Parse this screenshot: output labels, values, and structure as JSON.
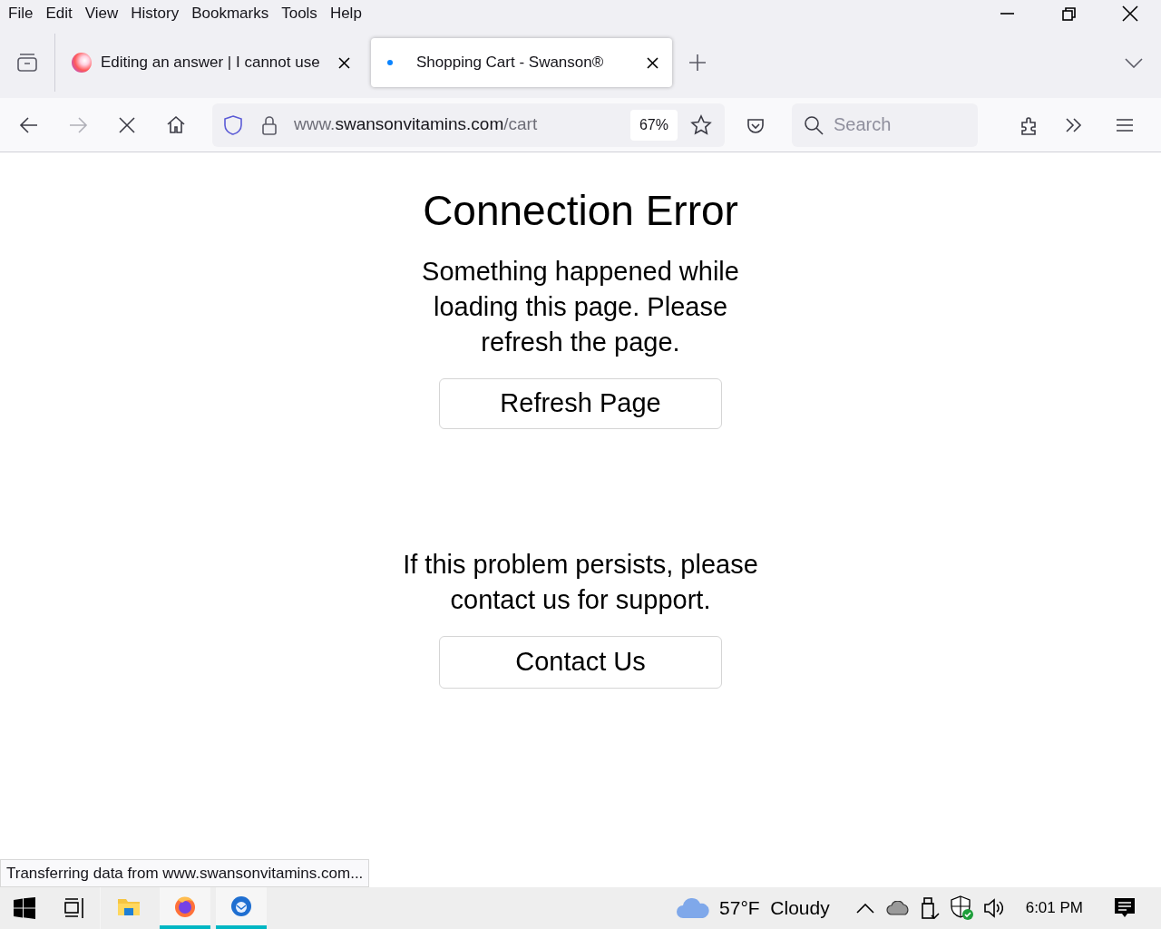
{
  "menu_bar": [
    "File",
    "Edit",
    "View",
    "History",
    "Bookmarks",
    "Tools",
    "Help"
  ],
  "tabs": [
    {
      "title": "Editing an answer | I cannot use",
      "selected": false,
      "kind": "favicon"
    },
    {
      "title": "Shopping Cart - Swanson®",
      "selected": true,
      "kind": "loading"
    }
  ],
  "nav_buttons": [
    {
      "kind": "back",
      "disabled": false
    },
    {
      "kind": "forward",
      "disabled": true
    },
    {
      "kind": "stop",
      "disabled": false
    },
    {
      "kind": "home",
      "disabled": false
    }
  ],
  "address_bar": {
    "prefix": "www.",
    "host": "swansonvitamins.com",
    "path": "/cart",
    "zoom": "67%"
  },
  "search": {
    "placeholder": "Search"
  },
  "page": {
    "title": "Connection Error",
    "message": "Something happened while loading this page. Please refresh the page.",
    "refresh_button": "Refresh Page",
    "support_message": "If this problem persists, please contact us for support.",
    "contact_button": "Contact Us"
  },
  "status_text": "Transferring data from www.swansonvitamins.com...",
  "taskbar": {
    "apps": [
      {
        "kind": "files",
        "open": false
      },
      {
        "kind": "firefox",
        "open": true
      },
      {
        "kind": "mail",
        "open": true
      }
    ],
    "weather": "57°F  Cloudy",
    "time": "6:01 PM"
  }
}
